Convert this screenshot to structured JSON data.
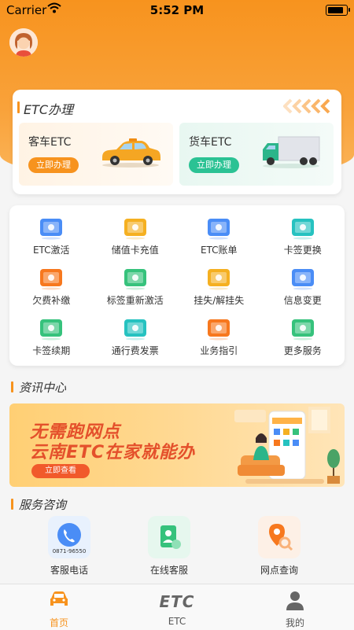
{
  "status_bar": {
    "carrier": "Carrier",
    "time": "5:52 PM"
  },
  "etc_section": {
    "title": "ETC办理",
    "car": {
      "title": "客车ETC",
      "button": "立即办理"
    },
    "truck": {
      "title": "货车ETC",
      "button": "立即办理"
    }
  },
  "services": [
    {
      "label": "ETC激活",
      "icon": "etc-activate-icon",
      "color": "#4a8df6"
    },
    {
      "label": "储值卡充值",
      "icon": "card-recharge-icon",
      "color": "#f5b021"
    },
    {
      "label": "ETC账单",
      "icon": "etc-bill-icon",
      "color": "#4a8df6"
    },
    {
      "label": "卡签更换",
      "icon": "card-replace-icon",
      "color": "#26c2c0"
    },
    {
      "label": "欠费补缴",
      "icon": "arrears-payment-icon",
      "color": "#f7781e"
    },
    {
      "label": "标签重新激活",
      "icon": "tag-reactivate-icon",
      "color": "#36c27c"
    },
    {
      "label": "挂失/解挂失",
      "icon": "report-loss-icon",
      "color": "#f5b021"
    },
    {
      "label": "信息变更",
      "icon": "info-change-icon",
      "color": "#4a8df6"
    },
    {
      "label": "卡签续期",
      "icon": "card-renew-icon",
      "color": "#36c27c"
    },
    {
      "label": "通行费发票",
      "icon": "toll-invoice-icon",
      "color": "#26c2c0"
    },
    {
      "label": "业务指引",
      "icon": "business-guide-icon",
      "color": "#f7781e"
    },
    {
      "label": "更多服务",
      "icon": "more-services-icon",
      "color": "#36c27c"
    }
  ],
  "news": {
    "title": "资讯中心",
    "banner_line1": "无需跑网点",
    "banner_line2": "云南ETC在家就能办",
    "banner_button": "立即查看"
  },
  "consult": {
    "title": "服务咨询",
    "phone_number": "0871-96550",
    "items": [
      {
        "label": "客服电话",
        "icon": "phone-icon"
      },
      {
        "label": "在线客服",
        "icon": "online-service-icon"
      },
      {
        "label": "网点查询",
        "icon": "outlet-search-icon"
      }
    ]
  },
  "tabbar": {
    "home": "首页",
    "etc": "ETC",
    "mine": "我的",
    "logo_text": "ETC",
    "active_color": "#f7931e",
    "inactive_color": "#555555"
  }
}
